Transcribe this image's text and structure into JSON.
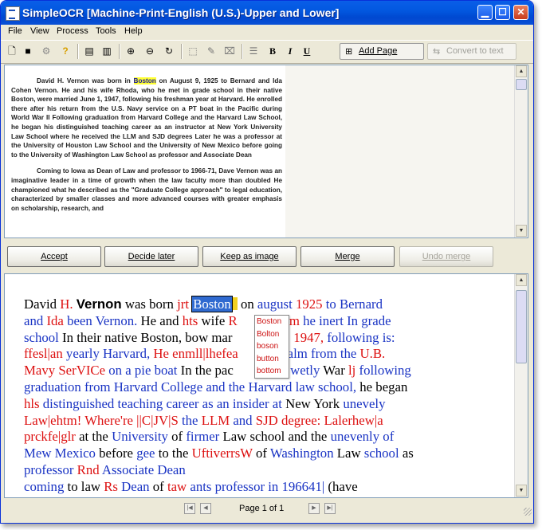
{
  "window": {
    "title": "SimpleOCR [Machine-Print-English (U.S.)-Upper and Lower]"
  },
  "title_buttons": {
    "minimize": "▁",
    "maximize": "☐",
    "close": "✕"
  },
  "menu": [
    "File",
    "View",
    "Process",
    "Tools",
    "Help"
  ],
  "toolbar": {
    "add_page": "Add Page",
    "convert": "Convert to text",
    "bold_glyph": "B",
    "italic_glyph": "I",
    "underline_glyph": "U",
    "icons": [
      "new-document-icon",
      "save-icon",
      "settings-icon",
      "help-icon",
      "single-page-icon",
      "multi-page-icon",
      "zoom-in-icon",
      "zoom-out-icon",
      "rotate-icon",
      "select-region-icon",
      "edit-region-icon",
      "delete-region-icon",
      "list-icon",
      "bold-icon",
      "italic-icon",
      "underline-icon"
    ]
  },
  "scan": {
    "p1_pre": "David H. Vernon was born in ",
    "p1_hl": "Boston",
    "p1_post": " on August 9, 1925 to Bernard and Ida Cohen Vernon.  He and his wife Rhoda, who he met in grade school in their native Boston, were married June 1, 1947, following his freshman year at Harvard.  He enrolled there after his return from the U.S. Navy service on a PT boat in the Pacific during World War II   Following graduation from Harvard College and the Harvard Law School, he began his distinguished teaching career as an instructor at New York University Law School where he received the LLM and SJD degrees   Later he was a professor at the University of Houston Law School and the University of New Mexico before going to the University of Washington Law School as professor and Associate Dean",
    "p2": "Coming to Iowa as Dean of Law and professor to 1966-71, Dave Vernon was an imaginative leader in a time of growth when the law faculty more than doubled   He championed what he described as the \"Graduate College approach\" to legal education, characterized by smaller classes and more advanced courses with greater emphasis on scholarship, research, and"
  },
  "actions": {
    "accept": "Accept",
    "decide_later": "Decide later",
    "keep_as_image": "Keep as image",
    "merge": "Merge",
    "undo_merge": "Undo merge"
  },
  "ocr_lines": [
    [
      [
        "k",
        "David "
      ],
      [
        "r",
        "H. "
      ],
      [
        "kb",
        "Vernon"
      ],
      [
        "k",
        " was born "
      ],
      [
        "r",
        "jrt "
      ],
      [
        "sel",
        "Boston"
      ],
      [
        "caret",
        ""
      ],
      [
        "k",
        " on "
      ],
      [
        "b",
        "august "
      ],
      [
        "r",
        "1925 "
      ],
      [
        "b",
        "to Bernard"
      ]
    ],
    [
      [
        "b",
        "and "
      ],
      [
        "r",
        "Ida "
      ],
      [
        "b",
        "been Vernon. "
      ],
      [
        "k",
        "He and "
      ],
      [
        "r",
        "hts "
      ],
      [
        "k",
        "wife "
      ],
      [
        "r",
        "R"
      ],
      [
        "gap",
        ""
      ],
      [
        "r",
        ", wlm "
      ],
      [
        "b",
        "he inert In grade"
      ]
    ],
    [
      [
        "b",
        "school "
      ],
      [
        "k",
        "In their native Boston, bow mar"
      ],
      [
        "gap",
        ""
      ],
      [
        "k",
        "ne "
      ],
      [
        "r",
        "1, 1947, "
      ],
      [
        "b",
        "following is:"
      ]
    ],
    [
      [
        "r",
        "ffesl|an "
      ],
      [
        "b",
        "yearly Harvard, "
      ],
      [
        "r",
        "He enmll|lhefea"
      ],
      [
        "gap",
        ""
      ],
      [
        "r",
        "; "
      ],
      [
        "b",
        "realm from the "
      ],
      [
        "r",
        "U.B."
      ]
    ],
    [
      [
        "r",
        "Mavy SerVICe "
      ],
      [
        "b",
        "on a pie boat "
      ],
      [
        "k",
        "In the pac"
      ],
      [
        "gap",
        ""
      ],
      [
        "b",
        "ring wetly "
      ],
      [
        "k",
        "War "
      ],
      [
        "r",
        "lj "
      ],
      [
        "b",
        "following"
      ]
    ],
    [
      [
        "b",
        "graduation from Harvard College and the Harvard law school, "
      ],
      [
        "k",
        "he began"
      ]
    ],
    [
      [
        "r",
        "hls "
      ],
      [
        "b",
        "distinguished teaching career as an insider at "
      ],
      [
        "k",
        "New York "
      ],
      [
        "b",
        "unevely"
      ]
    ],
    [
      [
        "r",
        "Law|ehtm! Where're ||C|JV|S "
      ],
      [
        "b",
        "the "
      ],
      [
        "r",
        "LLM "
      ],
      [
        "b",
        "and "
      ],
      [
        "r",
        "SJD degree: Lalerhew|a"
      ]
    ],
    [
      [
        "r",
        "prckfe|glr "
      ],
      [
        "k",
        "at the "
      ],
      [
        "b",
        "University "
      ],
      [
        "k",
        "of "
      ],
      [
        "b",
        "firmer "
      ],
      [
        "k",
        "Law school and the "
      ],
      [
        "b",
        "unevenly of"
      ]
    ],
    [
      [
        "b",
        "Mew Mexico "
      ],
      [
        "k",
        "before "
      ],
      [
        "b",
        "gee "
      ],
      [
        "k",
        "to the "
      ],
      [
        "r",
        "UftiverrsW "
      ],
      [
        "k",
        "of "
      ],
      [
        "b",
        "Washington "
      ],
      [
        "k",
        "Law "
      ],
      [
        "b",
        "school "
      ],
      [
        "k",
        "as"
      ]
    ],
    [
      [
        "b",
        "professor "
      ],
      [
        "r",
        "Rnd "
      ],
      [
        "b",
        "Associate Dean"
      ]
    ],
    [
      [
        "b",
        "coming "
      ],
      [
        "k",
        "to law "
      ],
      [
        "r",
        "Rs "
      ],
      [
        "b",
        "Dean "
      ],
      [
        "k",
        "of "
      ],
      [
        "r",
        "taw "
      ],
      [
        "b",
        "ants professor in 196641| "
      ],
      [
        "k",
        "(have"
      ]
    ]
  ],
  "suggestions": [
    "Boston",
    "Bolton",
    "boson",
    "button",
    "bottom"
  ],
  "status": {
    "page_label": "Page 1 of 1"
  },
  "nav": {
    "first": "|◀",
    "prev": "◀",
    "next": "▶",
    "last": "▶|"
  }
}
